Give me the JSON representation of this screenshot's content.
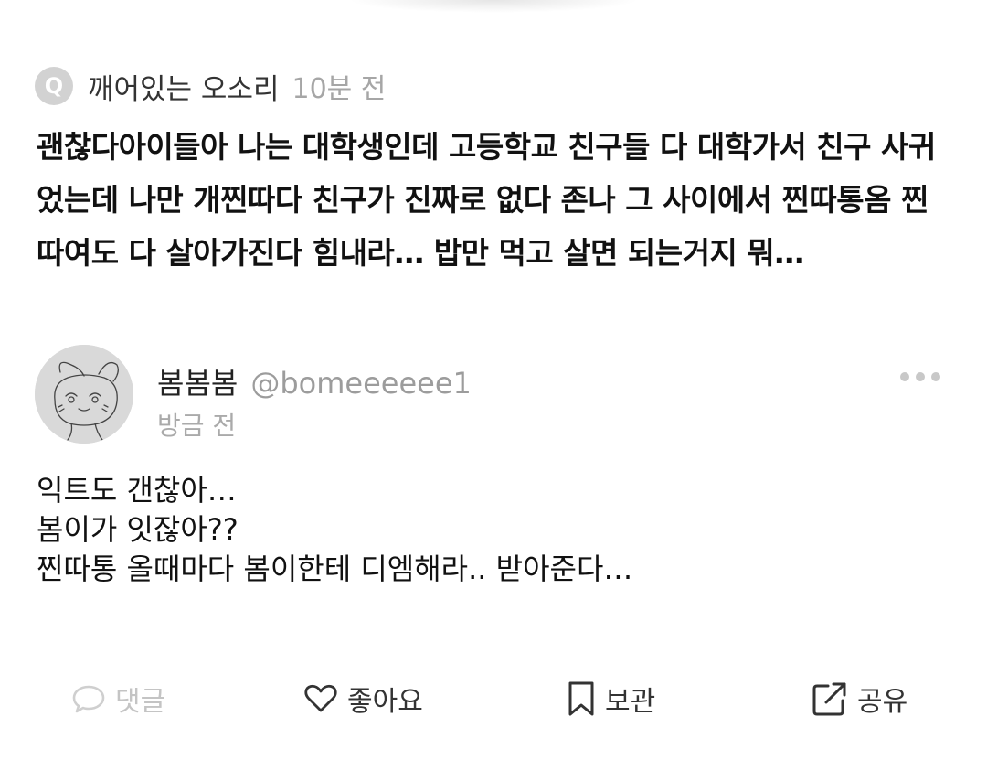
{
  "question": {
    "badge": "Q",
    "author": "깨어있는 오소리",
    "time": "10분 전",
    "body": "괜찮다아이들아 나는 대학생인데 고등학교 친구들 다 대학가서 친구 사귀었는데 나만 개찐따다 친구가 진짜로 없다 존나 그 사이에서 찐따통옴 찐따여도 다 살아가진다 힘내라… 밥만 먹고 살면 되는거지 뭐…"
  },
  "answer": {
    "name": "봄봄봄",
    "handle": "@bomeeeeee1",
    "time": "방금 전",
    "lines": [
      "익트도 갠찮아…",
      "봄이가 잇잖아??",
      "찐따통 올때마다 봄이한테 디엠해라.. 받아준다…"
    ]
  },
  "actions": {
    "comment": "댓글",
    "like": "좋아요",
    "save": "보관",
    "share": "공유"
  },
  "icons": {
    "question_badge": "q-badge-icon",
    "more": "more-dots-icon",
    "comment": "comment-bubble-icon",
    "like": "heart-icon",
    "save": "bookmark-icon",
    "share": "share-icon"
  },
  "colors": {
    "text": "#111111",
    "muted": "#a6a6a6",
    "disabled": "#c4c4c4",
    "badge": "#d2d2d2"
  }
}
